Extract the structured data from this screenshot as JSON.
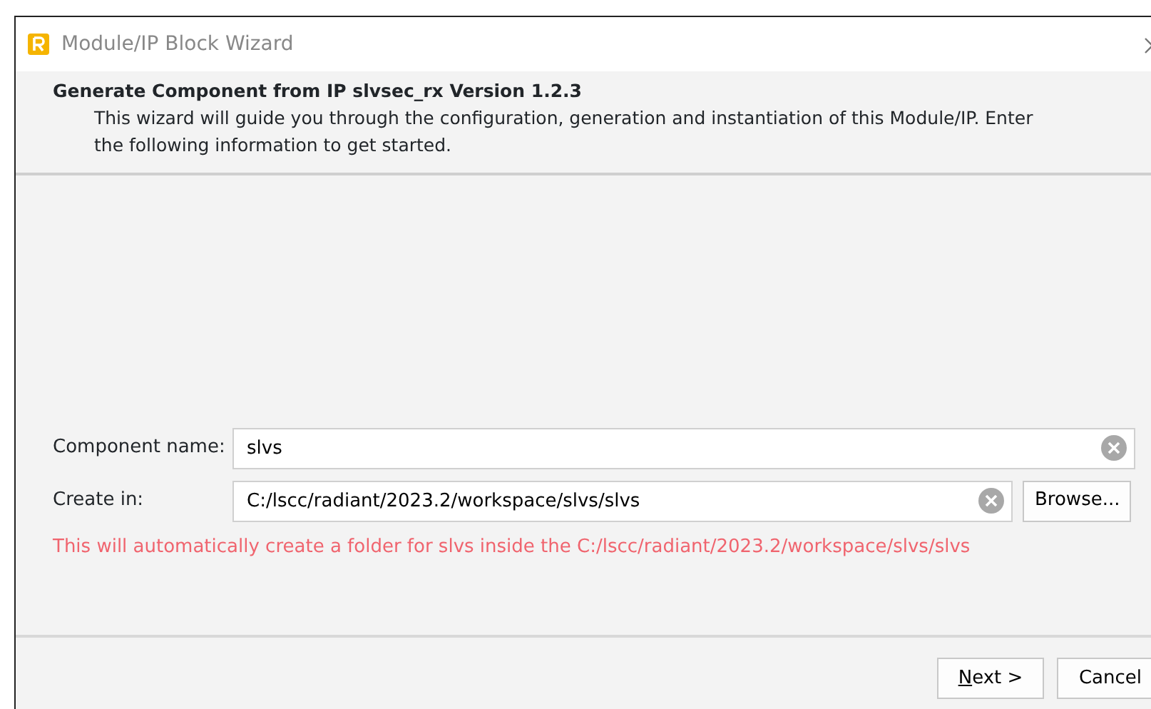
{
  "window": {
    "title": "Module/IP Block Wizard"
  },
  "header": {
    "title": "Generate Component from IP slvsec_rx Version 1.2.3",
    "description": "This wizard will guide you through the configuration, generation and instantiation of this Module/IP. Enter the following information to get started."
  },
  "fields": [
    {
      "label": "Component name:",
      "value": "slvs",
      "kind": "text"
    },
    {
      "label": "Create in:",
      "value": "C:/lscc/radiant/2023.2/workspace/slvs/slvs",
      "kind": "browse",
      "button": "Browse..."
    }
  ],
  "message": "This will automatically create a folder for slvs inside the C:/lscc/radiant/2023.2/workspace/slvs/slvs",
  "buttons": [
    {
      "label": "Next >",
      "mnemonic": true
    },
    {
      "label": "Cancel",
      "mnemonic": false
    }
  ]
}
